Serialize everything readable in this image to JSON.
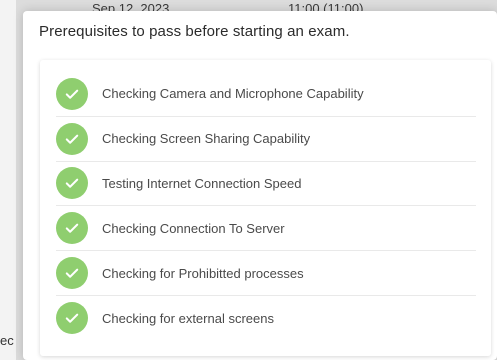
{
  "background": {
    "date_text": "Sep 12, 2023",
    "time_text": "11:00 (11:00)",
    "cut_text": "ec"
  },
  "modal": {
    "title": "Prerequisites to pass before starting an exam.",
    "accent_color": "#8fce6f",
    "checks": [
      {
        "label": "Checking Camera and Microphone Capability",
        "status": "passed",
        "icon": "check-circle-icon"
      },
      {
        "label": "Checking Screen Sharing Capability",
        "status": "passed",
        "icon": "check-circle-icon"
      },
      {
        "label": "Testing Internet Connection Speed",
        "status": "passed",
        "icon": "check-circle-icon"
      },
      {
        "label": "Checking Connection To Server",
        "status": "passed",
        "icon": "check-circle-icon"
      },
      {
        "label": "Checking for Prohibitted processes",
        "status": "passed",
        "icon": "check-circle-icon"
      },
      {
        "label": "Checking for external screens",
        "status": "passed",
        "icon": "check-circle-icon"
      }
    ]
  }
}
